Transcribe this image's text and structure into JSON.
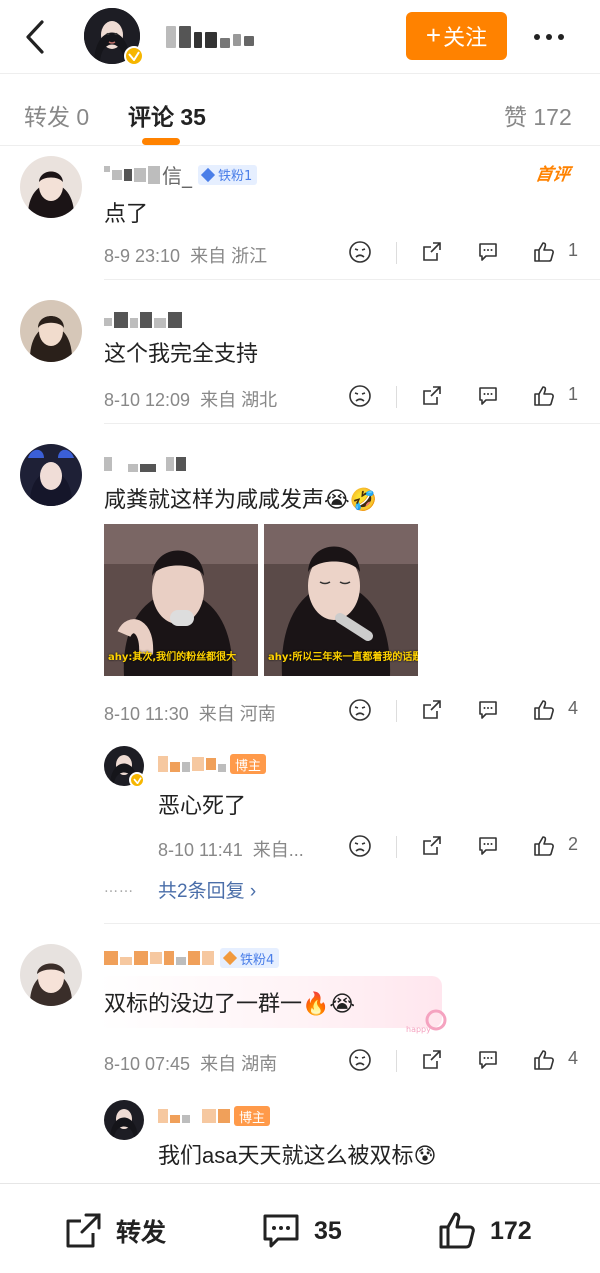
{
  "header": {
    "follow_label": "关注",
    "follow_plus": "+",
    "accent": "#ff8200"
  },
  "tabs": {
    "repost": "转发 0",
    "comments": "评论 35",
    "likes": "赞 172"
  },
  "comments": [
    {
      "name_suffix": "信_",
      "fan_badge": "铁粉1",
      "first_badge": "首评",
      "text": "点了",
      "time": "8-9 23:10",
      "from": "来自",
      "location": "浙江",
      "likes": "1"
    },
    {
      "text": "这个我完全支持",
      "time": "8-10 12:09",
      "from": "来自",
      "location": "湖北",
      "likes": "1"
    },
    {
      "text": "咸粪就这样为咸咸发声",
      "emoji1": "😭",
      "emoji2": "🤣",
      "images": [
        {
          "caption": "ahy:其次,我们的粉丝都很大"
        },
        {
          "caption": "ahy:所以三年来一直都着我的话题"
        }
      ],
      "time": "8-10 11:30",
      "from": "来自",
      "location": "河南",
      "likes": "4",
      "reply": {
        "badge": "博主",
        "text": "恶心死了",
        "time": "8-10 11:41",
        "from": "来自...",
        "likes": "2"
      },
      "replies_link": "共2条回复 ›",
      "replies_dots": "……"
    },
    {
      "fan_badge": "铁粉4",
      "text": "双标的没边了一群一",
      "emoji1": "🔥",
      "emoji2": "😭",
      "time": "8-10 07:45",
      "from": "来自",
      "location": "湖南",
      "likes": "4",
      "reply": {
        "badge": "博主",
        "text": "我们asa天天就这么被双标",
        "emoji": "😰"
      }
    }
  ],
  "bottom": {
    "repost": "转发",
    "comments": "35",
    "likes": "172"
  },
  "icons": [
    "back-arrow-icon",
    "verified-badge-icon",
    "more-dots-icon",
    "dislike-face-icon",
    "share-icon",
    "comment-icon",
    "thumbs-up-icon"
  ]
}
